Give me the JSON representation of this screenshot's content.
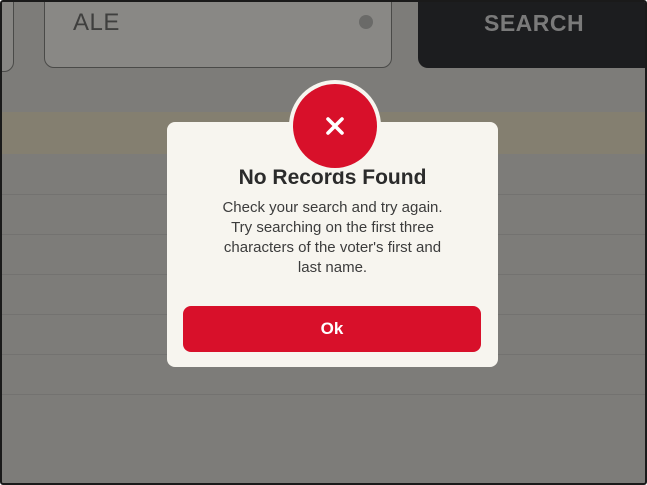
{
  "search": {
    "value": "ALE",
    "button_label": "SEARCH"
  },
  "dialog": {
    "icon": "close-icon",
    "title": "No Records Found",
    "message_lines": [
      "Check your search and try again.",
      "Try searching on the first three",
      "characters of the voter's first and",
      "last name."
    ],
    "ok_label": "Ok"
  },
  "colors": {
    "accent": "#d8102a",
    "overlay": "#7d7c79",
    "dialog_background": "#f7f5ef",
    "search_button": "#1c1d1f"
  }
}
